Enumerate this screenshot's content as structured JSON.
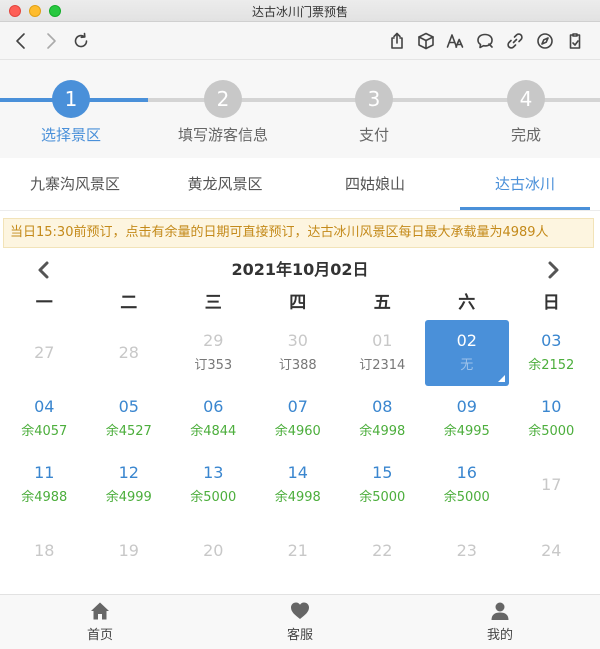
{
  "window": {
    "title": "达古冰川门票预售"
  },
  "toolbar": {
    "icons": [
      "back-icon",
      "forward-icon",
      "reload-icon",
      "share-icon",
      "cube-icon",
      "text-size-icon",
      "comment-icon",
      "link-icon",
      "compass-icon",
      "clipboard-icon"
    ]
  },
  "steps": [
    {
      "number": "1",
      "label": "选择景区",
      "active": true
    },
    {
      "number": "2",
      "label": "填写游客信息",
      "active": false
    },
    {
      "number": "3",
      "label": "支付",
      "active": false
    },
    {
      "number": "4",
      "label": "完成",
      "active": false
    }
  ],
  "tabs": [
    {
      "label": "九寨沟风景区",
      "active": false
    },
    {
      "label": "黄龙风景区",
      "active": false
    },
    {
      "label": "四姑娘山",
      "active": false
    },
    {
      "label": "达古冰川",
      "active": true
    }
  ],
  "notice": "当日15:30前预订，点击有余量的日期可直接预订，达古冰川风景区每日最大承载量为4989人",
  "calendar": {
    "title": "2021年10月02日",
    "weekdays": [
      "一",
      "二",
      "三",
      "四",
      "五",
      "六",
      "日"
    ],
    "rows": [
      [
        {
          "day": "27",
          "sub": "",
          "state": "disabled"
        },
        {
          "day": "28",
          "sub": "",
          "state": "disabled"
        },
        {
          "day": "29",
          "sub": "订353",
          "state": "booked"
        },
        {
          "day": "30",
          "sub": "订388",
          "state": "booked"
        },
        {
          "day": "01",
          "sub": "订2314",
          "state": "booked"
        },
        {
          "day": "02",
          "sub": "无",
          "state": "selected"
        },
        {
          "day": "03",
          "sub": "余2152",
          "state": "avail"
        }
      ],
      [
        {
          "day": "04",
          "sub": "余4057",
          "state": "avail"
        },
        {
          "day": "05",
          "sub": "余4527",
          "state": "avail"
        },
        {
          "day": "06",
          "sub": "余4844",
          "state": "avail"
        },
        {
          "day": "07",
          "sub": "余4960",
          "state": "avail"
        },
        {
          "day": "08",
          "sub": "余4998",
          "state": "avail"
        },
        {
          "day": "09",
          "sub": "余4995",
          "state": "avail"
        },
        {
          "day": "10",
          "sub": "余5000",
          "state": "avail"
        }
      ],
      [
        {
          "day": "11",
          "sub": "余4988",
          "state": "avail"
        },
        {
          "day": "12",
          "sub": "余4999",
          "state": "avail"
        },
        {
          "day": "13",
          "sub": "余5000",
          "state": "avail"
        },
        {
          "day": "14",
          "sub": "余4998",
          "state": "avail"
        },
        {
          "day": "15",
          "sub": "余5000",
          "state": "avail"
        },
        {
          "day": "16",
          "sub": "余5000",
          "state": "avail"
        },
        {
          "day": "17",
          "sub": "",
          "state": "disabled"
        }
      ],
      [
        {
          "day": "18",
          "sub": "",
          "state": "disabled"
        },
        {
          "day": "19",
          "sub": "",
          "state": "disabled"
        },
        {
          "day": "20",
          "sub": "",
          "state": "disabled"
        },
        {
          "day": "21",
          "sub": "",
          "state": "disabled"
        },
        {
          "day": "22",
          "sub": "",
          "state": "disabled"
        },
        {
          "day": "23",
          "sub": "",
          "state": "disabled"
        },
        {
          "day": "24",
          "sub": "",
          "state": "disabled"
        }
      ]
    ]
  },
  "bottom_nav": [
    {
      "label": "首页",
      "icon": "home-icon"
    },
    {
      "label": "客服",
      "icon": "heart-icon"
    },
    {
      "label": "我的",
      "icon": "user-icon"
    }
  ],
  "colors": {
    "accent": "#4a90d9",
    "available": "#4cae3c",
    "notice_text": "#c48a1a",
    "notice_bg": "#fdf5e0"
  }
}
